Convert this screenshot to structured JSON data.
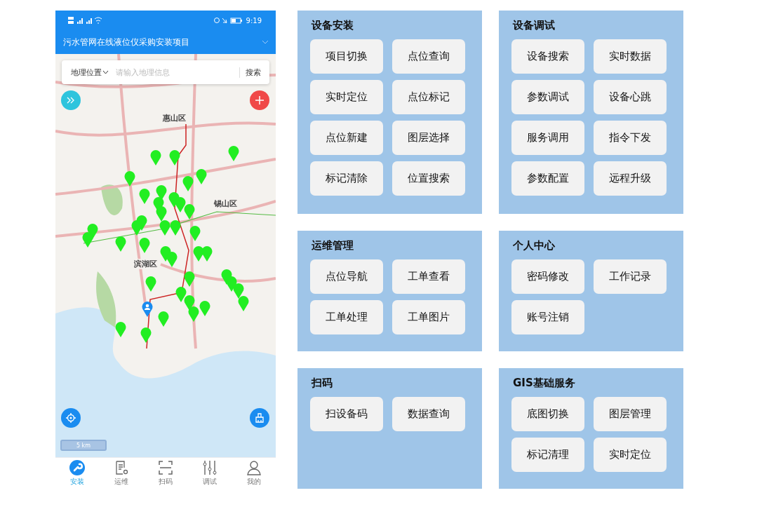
{
  "phone": {
    "status_bar": {
      "time": "9:19"
    },
    "title_bar": {
      "title": "污水管网在线液位仪采购安装项目"
    },
    "search": {
      "scope": "地理位置",
      "placeholder": "请输入地理信息",
      "button": "搜索"
    },
    "map": {
      "labels": [
        "惠山区",
        "锡山区",
        "滨湖区"
      ],
      "scale": "5 km"
    },
    "tab_bar": [
      {
        "label": "安装",
        "selected": true,
        "kind": "wrench"
      },
      {
        "label": "运维",
        "selected": false,
        "kind": "document"
      },
      {
        "label": "扫码",
        "selected": false,
        "kind": "scan"
      },
      {
        "label": "调试",
        "selected": false,
        "kind": "sliders"
      },
      {
        "label": "我的",
        "selected": false,
        "kind": "person"
      }
    ]
  },
  "panels": [
    {
      "title": "设备安装",
      "buttons": [
        "项目切换",
        "点位查询",
        "实时定位",
        "点位标记",
        "点位新建",
        "图层选择",
        "标记清除",
        "位置搜索"
      ]
    },
    {
      "title": "设备调试",
      "buttons": [
        "设备搜索",
        "实时数据",
        "参数调试",
        "设备心跳",
        "服务调用",
        "指令下发",
        "参数配置",
        "远程升级"
      ]
    },
    {
      "title": "运维管理",
      "buttons": [
        "点位导航",
        "工单查看",
        "工单处理",
        "工单图片"
      ]
    },
    {
      "title": "个人中心",
      "buttons": [
        "密码修改",
        "工作记录",
        "账号注销"
      ]
    },
    {
      "title": "扫码",
      "buttons": [
        "扫设备码",
        "数据查询"
      ]
    },
    {
      "title": "GIS基础服务",
      "buttons": [
        "底图切换",
        "图层管理",
        "标记清理",
        "实时定位"
      ]
    }
  ]
}
